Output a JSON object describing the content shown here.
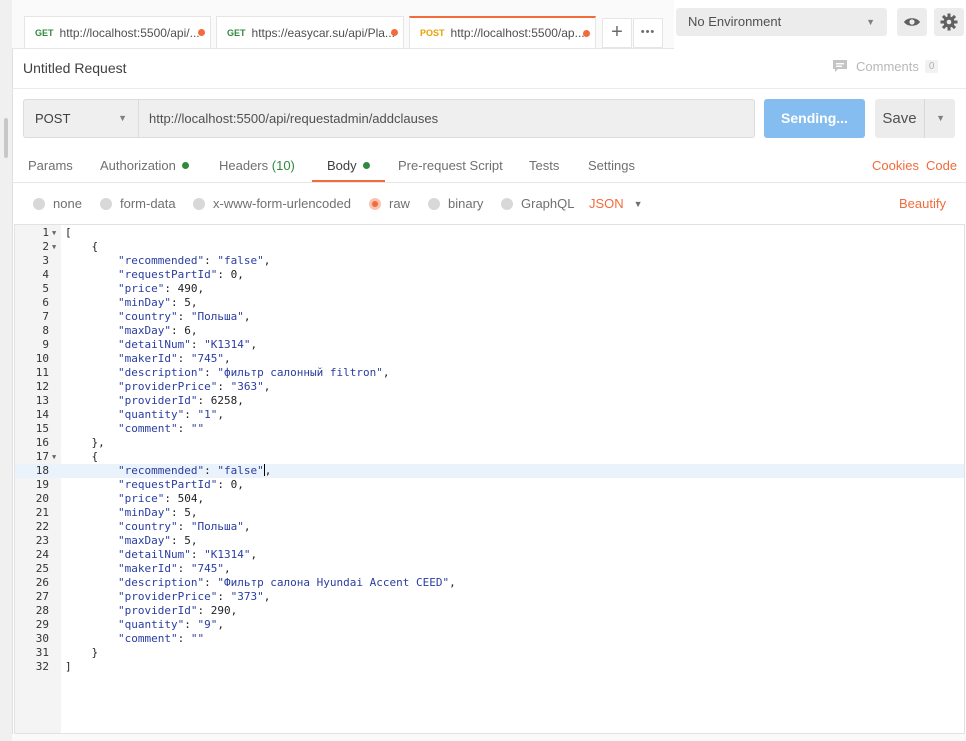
{
  "tabs": [
    {
      "method": "GET",
      "url": "http://localhost:5500/api/..."
    },
    {
      "method": "GET",
      "url": "https://easycar.su/api/Pla..."
    },
    {
      "method": "POST",
      "url": "http://localhost:5500/ap..."
    }
  ],
  "tab_actions": {
    "new": "+",
    "more": "•••"
  },
  "environment": {
    "selected": "No Environment"
  },
  "request": {
    "title": "Untitled Request",
    "comments_label": "Comments",
    "comments_count": "0",
    "method": "POST",
    "url": "http://localhost:5500/api/requestadmin/addclauses",
    "send_label": "Sending...",
    "save_label": "Save"
  },
  "request_tabs": {
    "params": "Params",
    "authorization": "Authorization",
    "headers": "Headers",
    "headers_count": "(10)",
    "body": "Body",
    "pre_request": "Pre-request Script",
    "tests": "Tests",
    "settings": "Settings",
    "cookies": "Cookies",
    "code": "Code"
  },
  "body_options": {
    "none": "none",
    "form_data": "form-data",
    "urlencoded": "x-www-form-urlencoded",
    "raw": "raw",
    "binary": "binary",
    "graphql": "GraphQL",
    "format": "JSON",
    "beautify": "Beautify"
  },
  "editor": {
    "lines": [
      "[",
      "    {",
      "        \"recommended\": \"false\",",
      "        \"requestPartId\": 0,",
      "        \"price\": 490,",
      "        \"minDay\": 5,",
      "        \"country\": \"Польша\",",
      "        \"maxDay\": 6,",
      "        \"detailNum\": \"K1314\",",
      "        \"makerId\": \"745\",",
      "        \"description\": \"фильтр салонный filtron\",",
      "        \"providerPrice\": \"363\",",
      "        \"providerId\": 6258,",
      "        \"quantity\": \"1\",",
      "        \"comment\": \"\"",
      "    },",
      "    {",
      "        \"recommended\": \"false\",",
      "        \"requestPartId\": 0,",
      "        \"price\": 504,",
      "        \"minDay\": 5,",
      "        \"country\": \"Польша\",",
      "        \"maxDay\": 5,",
      "        \"detailNum\": \"K1314\",",
      "        \"makerId\": \"745\",",
      "        \"description\": \"Фильтр салона Hyundai Accent CEED\",",
      "        \"providerPrice\": \"373\",",
      "        \"providerId\": 290,",
      "        \"quantity\": \"9\",",
      "        \"comment\": \"\"",
      "    }",
      "]"
    ],
    "folded_lines": [
      1,
      2,
      17
    ],
    "highlighted_line": 18
  },
  "colors": {
    "accent": "#f26b3a",
    "send": "#86bdf0",
    "get": "#2f8a3e",
    "post": "#e8a200"
  }
}
